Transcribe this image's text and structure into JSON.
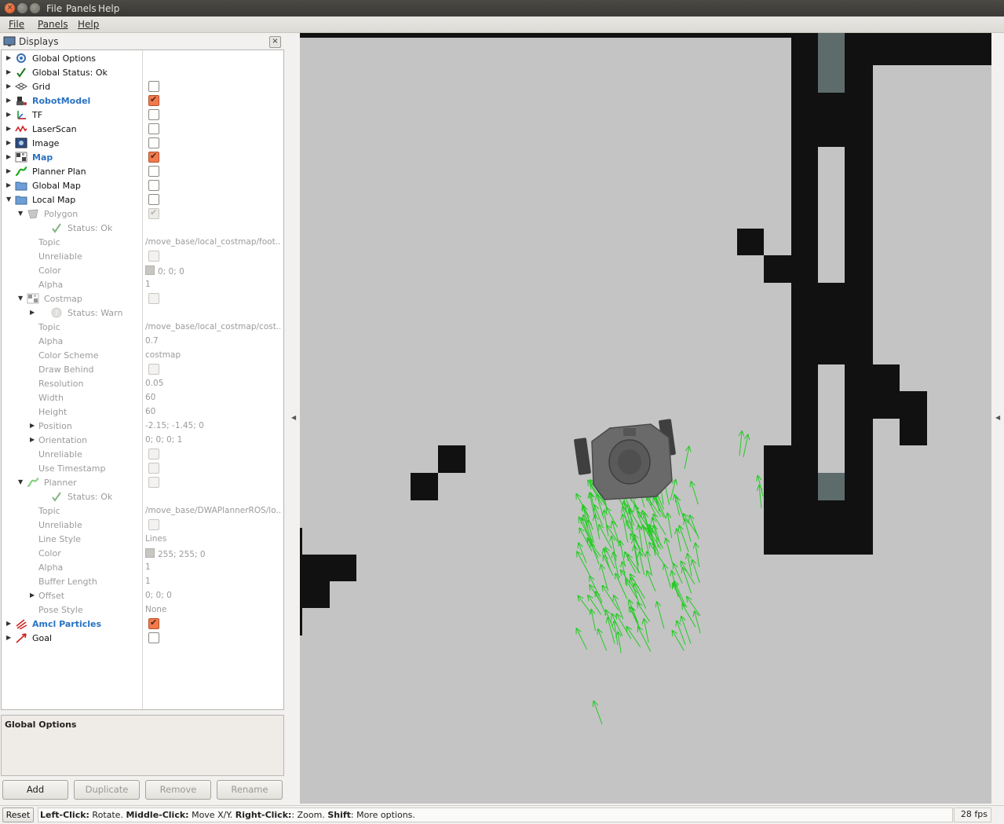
{
  "window": {
    "menu": [
      "File",
      "Panels",
      "Help"
    ]
  },
  "menubar": {
    "file": "File",
    "panels": "Panels",
    "help": "Help"
  },
  "displays_panel": {
    "title": "Displays",
    "items": [
      {
        "label": "Global Options",
        "icon": "gear-icon",
        "depth": 0,
        "expander": "collapsed",
        "style": "normal",
        "checkbox": "none",
        "value": ""
      },
      {
        "label": "Global Status: Ok",
        "icon": "checkmark-icon",
        "depth": 0,
        "expander": "collapsed",
        "style": "normal",
        "checkbox": "none",
        "value": ""
      },
      {
        "label": "Grid",
        "icon": "grid-icon",
        "depth": 0,
        "expander": "collapsed",
        "style": "normal",
        "checkbox": "unchecked",
        "value": ""
      },
      {
        "label": "RobotModel",
        "icon": "robot-icon",
        "depth": 0,
        "expander": "collapsed",
        "style": "blue",
        "checkbox": "checked",
        "value": ""
      },
      {
        "label": "TF",
        "icon": "tf-axes-icon",
        "depth": 0,
        "expander": "collapsed",
        "style": "normal",
        "checkbox": "unchecked",
        "value": ""
      },
      {
        "label": "LaserScan",
        "icon": "laser-scan-icon",
        "depth": 0,
        "expander": "collapsed",
        "style": "normal",
        "checkbox": "unchecked",
        "value": ""
      },
      {
        "label": "Image",
        "icon": "image-icon",
        "depth": 0,
        "expander": "collapsed",
        "style": "normal",
        "checkbox": "unchecked",
        "value": ""
      },
      {
        "label": "Map",
        "icon": "map-icon",
        "depth": 0,
        "expander": "collapsed",
        "style": "blue",
        "checkbox": "checked",
        "value": ""
      },
      {
        "label": "Planner Plan",
        "icon": "path-icon",
        "depth": 0,
        "expander": "collapsed",
        "style": "normal",
        "checkbox": "unchecked",
        "value": ""
      },
      {
        "label": "Global Map",
        "icon": "folder-icon",
        "depth": 0,
        "expander": "collapsed",
        "style": "normal",
        "checkbox": "unchecked",
        "value": ""
      },
      {
        "label": "Local Map",
        "icon": "folder-icon",
        "depth": 0,
        "expander": "expanded",
        "style": "normal",
        "checkbox": "unchecked",
        "value": ""
      },
      {
        "label": "Polygon",
        "icon": "polygon-icon",
        "depth": 1,
        "expander": "expanded",
        "style": "dim",
        "checkbox": "dim-checked",
        "value": ""
      },
      {
        "label": "Status: Ok",
        "icon": "checkmark-icon",
        "depth": 2,
        "expander": "none",
        "style": "dim",
        "checkbox": "none",
        "value": ""
      },
      {
        "label": "Topic",
        "icon": "",
        "depth": 2,
        "expander": "none",
        "style": "dim",
        "checkbox": "none",
        "value": "/move_base/local_costmap/foot..."
      },
      {
        "label": "Unreliable",
        "icon": "",
        "depth": 2,
        "expander": "none",
        "style": "dim",
        "checkbox": "dim",
        "value": ""
      },
      {
        "label": "Color",
        "icon": "",
        "depth": 2,
        "expander": "none",
        "style": "dim",
        "checkbox": "none",
        "value": "0; 0; 0",
        "swatch": true
      },
      {
        "label": "Alpha",
        "icon": "",
        "depth": 2,
        "expander": "none",
        "style": "dim",
        "checkbox": "none",
        "value": "1"
      },
      {
        "label": "Costmap",
        "icon": "map-icon",
        "depth": 1,
        "expander": "expanded",
        "style": "dim",
        "checkbox": "dim",
        "value": ""
      },
      {
        "label": "Status: Warn",
        "icon": "warning-icon",
        "depth": 2,
        "expander": "collapsed",
        "style": "dim",
        "checkbox": "none",
        "value": ""
      },
      {
        "label": "Topic",
        "icon": "",
        "depth": 2,
        "expander": "none",
        "style": "dim",
        "checkbox": "none",
        "value": "/move_base/local_costmap/cost..."
      },
      {
        "label": "Alpha",
        "icon": "",
        "depth": 2,
        "expander": "none",
        "style": "dim",
        "checkbox": "none",
        "value": "0.7"
      },
      {
        "label": "Color Scheme",
        "icon": "",
        "depth": 2,
        "expander": "none",
        "style": "dim",
        "checkbox": "none",
        "value": "costmap"
      },
      {
        "label": "Draw Behind",
        "icon": "",
        "depth": 2,
        "expander": "none",
        "style": "dim",
        "checkbox": "dim",
        "value": ""
      },
      {
        "label": "Resolution",
        "icon": "",
        "depth": 2,
        "expander": "none",
        "style": "dim",
        "checkbox": "none",
        "value": "0.05"
      },
      {
        "label": "Width",
        "icon": "",
        "depth": 2,
        "expander": "none",
        "style": "dim",
        "checkbox": "none",
        "value": "60"
      },
      {
        "label": "Height",
        "icon": "",
        "depth": 2,
        "expander": "none",
        "style": "dim",
        "checkbox": "none",
        "value": "60"
      },
      {
        "label": "Position",
        "icon": "",
        "depth": 2,
        "expander": "collapsed",
        "style": "dim",
        "checkbox": "none",
        "value": "-2.15; -1.45; 0"
      },
      {
        "label": "Orientation",
        "icon": "",
        "depth": 2,
        "expander": "collapsed",
        "style": "dim",
        "checkbox": "none",
        "value": "0; 0; 0; 1"
      },
      {
        "label": "Unreliable",
        "icon": "",
        "depth": 2,
        "expander": "none",
        "style": "dim",
        "checkbox": "dim",
        "value": ""
      },
      {
        "label": "Use Timestamp",
        "icon": "",
        "depth": 2,
        "expander": "none",
        "style": "dim",
        "checkbox": "dim",
        "value": ""
      },
      {
        "label": "Planner",
        "icon": "path-icon",
        "depth": 1,
        "expander": "expanded",
        "style": "dim",
        "checkbox": "dim",
        "value": ""
      },
      {
        "label": "Status: Ok",
        "icon": "checkmark-icon",
        "depth": 2,
        "expander": "none",
        "style": "dim",
        "checkbox": "none",
        "value": ""
      },
      {
        "label": "Topic",
        "icon": "",
        "depth": 2,
        "expander": "none",
        "style": "dim",
        "checkbox": "none",
        "value": "/move_base/DWAPlannerROS/lo..."
      },
      {
        "label": "Unreliable",
        "icon": "",
        "depth": 2,
        "expander": "none",
        "style": "dim",
        "checkbox": "dim",
        "value": ""
      },
      {
        "label": "Line Style",
        "icon": "",
        "depth": 2,
        "expander": "none",
        "style": "dim",
        "checkbox": "none",
        "value": "Lines"
      },
      {
        "label": "Color",
        "icon": "",
        "depth": 2,
        "expander": "none",
        "style": "dim",
        "checkbox": "none",
        "value": "255; 255; 0",
        "swatch": true
      },
      {
        "label": "Alpha",
        "icon": "",
        "depth": 2,
        "expander": "none",
        "style": "dim",
        "checkbox": "none",
        "value": "1"
      },
      {
        "label": "Buffer Length",
        "icon": "",
        "depth": 2,
        "expander": "none",
        "style": "dim",
        "checkbox": "none",
        "value": "1"
      },
      {
        "label": "Offset",
        "icon": "",
        "depth": 2,
        "expander": "collapsed",
        "style": "dim",
        "checkbox": "none",
        "value": "0; 0; 0"
      },
      {
        "label": "Pose Style",
        "icon": "",
        "depth": 2,
        "expander": "none",
        "style": "dim",
        "checkbox": "none",
        "value": "None"
      },
      {
        "label": "Amcl Particles",
        "icon": "particles-icon",
        "depth": 0,
        "expander": "collapsed",
        "style": "blue",
        "checkbox": "checked",
        "value": ""
      },
      {
        "label": "Goal",
        "icon": "goal-arrow-icon",
        "depth": 0,
        "expander": "collapsed",
        "style": "normal",
        "checkbox": "unchecked",
        "value": ""
      }
    ],
    "description_title": "Global Options",
    "buttons": {
      "add": "Add",
      "duplicate": "Duplicate",
      "remove": "Remove",
      "rename": "Rename"
    }
  },
  "statusbar": {
    "reset": "Reset",
    "hint_parts": [
      {
        "text": "Left-Click:",
        "bold": true
      },
      {
        "text": " Rotate. ",
        "bold": false
      },
      {
        "text": "Middle-Click:",
        "bold": true
      },
      {
        "text": " Move X/Y. ",
        "bold": false
      },
      {
        "text": "Right-Click:",
        "bold": true
      },
      {
        "text": ": Zoom. ",
        "bold": false
      },
      {
        "text": "Shift",
        "bold": true
      },
      {
        "text": ": More options.",
        "bold": false
      }
    ],
    "fps": "28 fps"
  },
  "colors": {
    "map_free": "#c4c4c4",
    "map_occupied": "#111111",
    "map_unknown": "#5e6b6b",
    "particles": "#22cc22",
    "checkbox_checked": "#f27a4d",
    "enabled_display_label": "#2a73c2"
  }
}
